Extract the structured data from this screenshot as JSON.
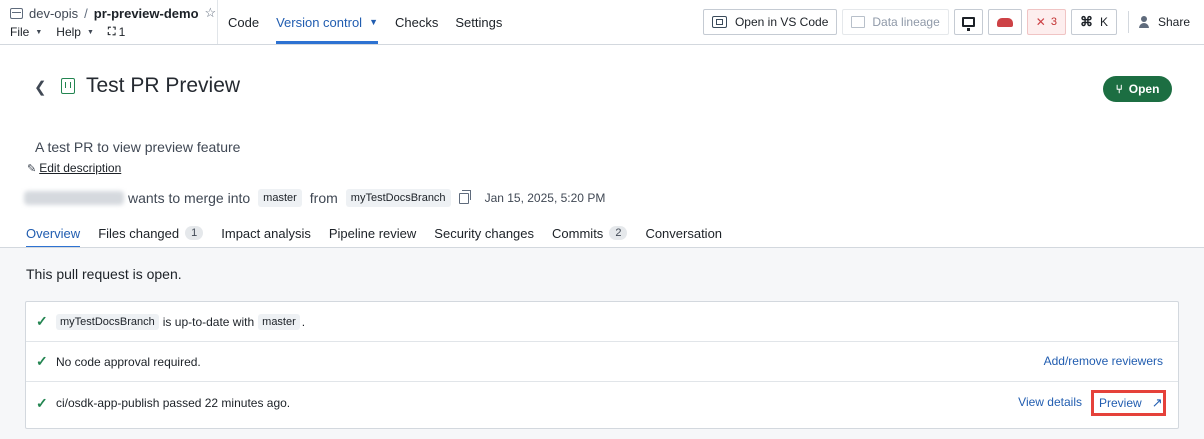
{
  "topbar": {
    "project_parent": "dev-opis",
    "project_separator": "/",
    "project_name": "pr-preview-demo",
    "menu_file": "File",
    "menu_help": "Help",
    "branch_count": "1",
    "tabs": [
      {
        "label": "Code",
        "active": false
      },
      {
        "label": "Version control",
        "active": true
      },
      {
        "label": "Checks",
        "active": false
      },
      {
        "label": "Settings",
        "active": false
      }
    ],
    "open_vscode_label": "Open in VS Code",
    "data_lineage_label": "Data lineage",
    "error_count": "3",
    "shortcut_label": "K",
    "share_label": "Share"
  },
  "pr": {
    "title": "Test PR Preview",
    "status_label": "Open",
    "description": "A test PR to view preview feature",
    "edit_description_label": "Edit description",
    "merge_text": "wants to merge into",
    "target_branch": "master",
    "from_text": "from",
    "source_branch": "myTestDocsBranch",
    "date": "Jan 15, 2025, 5:20 PM"
  },
  "subtabs": [
    {
      "label": "Overview",
      "count": null,
      "active": true
    },
    {
      "label": "Files changed",
      "count": "1",
      "active": false
    },
    {
      "label": "Impact analysis",
      "count": null,
      "active": false
    },
    {
      "label": "Pipeline review",
      "count": null,
      "active": false
    },
    {
      "label": "Security changes",
      "count": null,
      "active": false
    },
    {
      "label": "Commits",
      "count": "2",
      "active": false
    },
    {
      "label": "Conversation",
      "count": null,
      "active": false
    }
  ],
  "status": {
    "title": "This pull request is open.",
    "checks": {
      "uptodate_branch": "myTestDocsBranch",
      "uptodate_text": "is up-to-date with",
      "uptodate_target": "master",
      "uptodate_period": ".",
      "approval_text": "No code approval required.",
      "reviewers_link": "Add/remove reviewers",
      "ci_text": "ci/osdk-app-publish passed 22 minutes ago.",
      "view_details_link": "View details",
      "preview_link": "Preview"
    }
  },
  "colors": {
    "accent": "#2d72d2",
    "open_pill": "#1c6e42",
    "success": "#238551",
    "highlight_box": "#e5413a"
  }
}
